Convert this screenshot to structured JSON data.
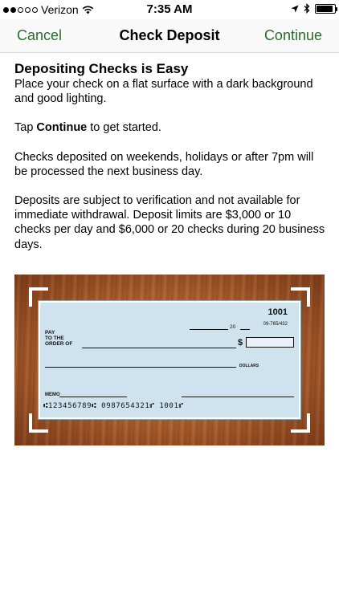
{
  "status_bar": {
    "carrier": "Verizon",
    "time": "7:35 AM",
    "signal_dots_filled": 2,
    "signal_dots_total": 5,
    "battery_level": 0.9,
    "icons": [
      "wifi-icon",
      "location-arrow-icon",
      "bluetooth-icon",
      "battery-icon"
    ]
  },
  "nav": {
    "cancel_label": "Cancel",
    "title": "Check Deposit",
    "continue_label": "Continue",
    "accent_color": "#2a6b2f"
  },
  "content": {
    "heading": "Depositing Checks is Easy",
    "intro": "Place your check on a flat surface with a dark background and good lighting.",
    "tap_prefix": "Tap ",
    "tap_bold": "Continue",
    "tap_suffix": " to get started.",
    "weekend_note": "Checks deposited on weekends, holidays or after 7pm will be processed the next business day.",
    "limits_note": "Deposits are subject to verification and not available for immediate withdrawal. Deposit limits are $3,000 or 10 checks per day and $6,000 or 20 checks during 20 business days."
  },
  "check": {
    "number": "1001",
    "routing_fraction": "09-765/432",
    "date_year_prefix": "20",
    "pay_line1": "PAY",
    "pay_line2": "TO THE",
    "pay_line3": "ORDER OF",
    "dollar_sign": "$",
    "dollars_label": "DOLLARS",
    "memo_label": "MEMO",
    "micr": "⑆123456789⑆  0987654321⑈  1001⑈"
  }
}
